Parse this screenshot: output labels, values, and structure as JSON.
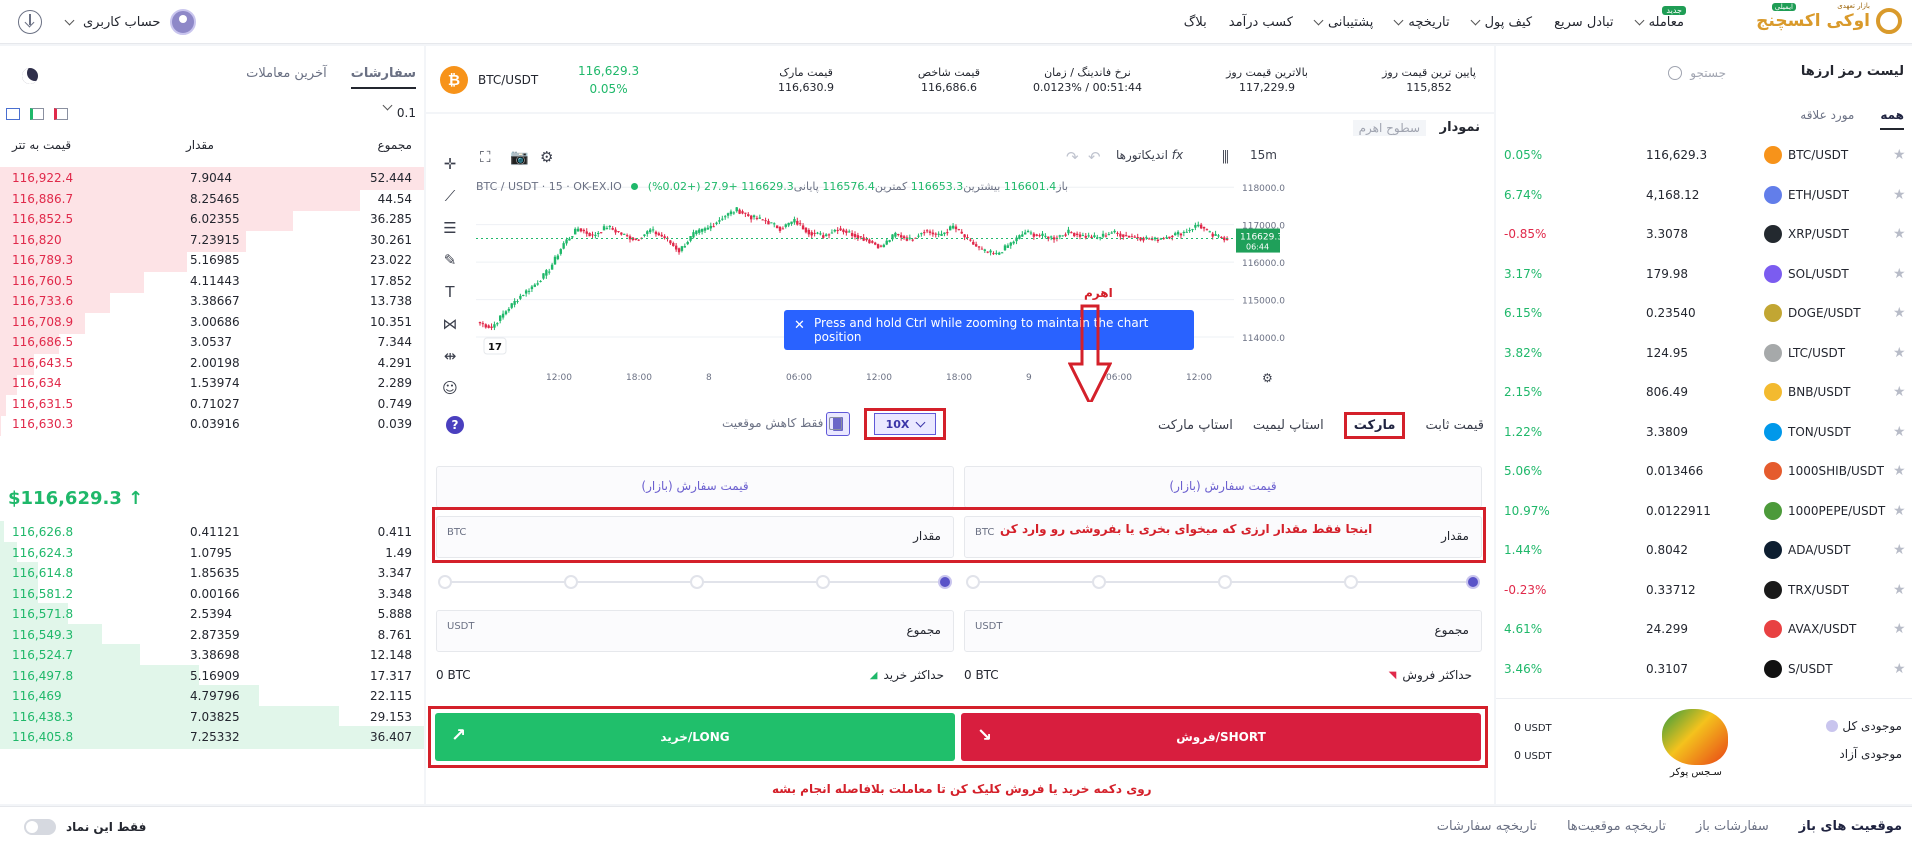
{
  "topbar": {
    "brand_name": "اوکی اکسچنج",
    "brand_tagline": "بازار تعهدی",
    "brand_badge": "ایمیلی",
    "nav": [
      {
        "label": "معامله",
        "badge": "جدید"
      },
      {
        "label": "تبادل سریع"
      },
      {
        "label": "کیف پول"
      },
      {
        "label": "تاریخچه"
      },
      {
        "label": "پشتیبانی"
      },
      {
        "label": "کسب درآمد"
      },
      {
        "label": "بلاگ"
      }
    ],
    "account_label": "حساب کاربری"
  },
  "market_list": {
    "title": "لیست رمز ارزها",
    "search_placeholder": "جستجو",
    "tabs": [
      "همه",
      "مورد علاقه"
    ],
    "pairs": [
      {
        "name": "BTC/USDT",
        "price": "116,629.3",
        "change": "0.05%",
        "dir": "pos",
        "color": "#f7931a"
      },
      {
        "name": "ETH/USDT",
        "price": "4,168.12",
        "change": "6.74%",
        "dir": "pos",
        "color": "#627eea"
      },
      {
        "name": "XRP/USDT",
        "price": "3.3078",
        "change": "-0.85%",
        "dir": "neg",
        "color": "#23292f"
      },
      {
        "name": "SOL/USDT",
        "price": "179.98",
        "change": "3.17%",
        "dir": "pos",
        "color": "#7b5cf0"
      },
      {
        "name": "DOGE/USDT",
        "price": "0.23540",
        "change": "6.15%",
        "dir": "pos",
        "color": "#c2a633"
      },
      {
        "name": "LTC/USDT",
        "price": "124.95",
        "change": "3.82%",
        "dir": "pos",
        "color": "#a6a9aa"
      },
      {
        "name": "BNB/USDT",
        "price": "806.49",
        "change": "2.15%",
        "dir": "pos",
        "color": "#f3ba2f"
      },
      {
        "name": "TON/USDT",
        "price": "3.3809",
        "change": "1.22%",
        "dir": "pos",
        "color": "#0098ea"
      },
      {
        "name": "1000SHIB/USDT",
        "price": "0.013466",
        "change": "5.06%",
        "dir": "pos",
        "color": "#e55b2d"
      },
      {
        "name": "1000PEPE/USDT",
        "price": "0.0122911",
        "change": "10.97%",
        "dir": "pos",
        "color": "#4c9a3a"
      },
      {
        "name": "ADA/USDT",
        "price": "0.8042",
        "change": "1.44%",
        "dir": "pos",
        "color": "#0d1e30"
      },
      {
        "name": "TRX/USDT",
        "price": "0.33712",
        "change": "-0.23%",
        "dir": "neg",
        "color": "#1a1a1a"
      },
      {
        "name": "AVAX/USDT",
        "price": "24.299",
        "change": "4.61%",
        "dir": "pos",
        "color": "#e84142"
      },
      {
        "name": "S/USDT",
        "price": "0.3107",
        "change": "3.46%",
        "dir": "pos",
        "color": "#111111"
      }
    ]
  },
  "balances": {
    "total_label": "موجودی کل",
    "total_value": "0",
    "total_unit": "USDT",
    "free_label": "موجودی آزاد",
    "free_value": "0",
    "free_unit": "USDT",
    "logo_caption": "سـجس پوکر"
  },
  "ticker": {
    "pair": "BTC/USDT",
    "price": "116,629.3",
    "change": "0.05%",
    "stats": [
      {
        "label": "پایین ترین قیمت روز",
        "value": "115,852"
      },
      {
        "label": "بالاترین قیمت روز",
        "value": "117,229.9"
      },
      {
        "label": "نرخ فاندینگ / زمان",
        "value": "00:51:44 / 0.0123%"
      },
      {
        "label": "قیمت شاخص",
        "value": "116,686.6"
      },
      {
        "label": "قیمت مارک",
        "value": "116,630.9"
      }
    ]
  },
  "chart": {
    "tab_chart": "نمودار",
    "tab_levels": "سطوح اهرم",
    "interval": "15m",
    "indicators": "اندیکاتورها",
    "symbol_line": "BTC / USDT · 15 · OK-EX.IO",
    "ohlc": {
      "o_label": "باز",
      "o": "116601.4",
      "h_label": "بیشترین",
      "h": "116653.3",
      "l_label": "کمترین",
      "l": "116576.4",
      "c_label": "پایانی",
      "c": "116629.3",
      "chg": "+27.9 (+0.02%)"
    },
    "price_tag": "116629.3",
    "price_tag_time": "06:44",
    "tip": "Press and hold Ctrl while zooming to maintain the chart position",
    "leverage_annotation": "اهرم"
  },
  "chart_data": {
    "type": "candlestick",
    "x_ticks": [
      "12:00",
      "18:00",
      "8",
      "06:00",
      "12:00",
      "18:00",
      "9",
      "06:00",
      "12:00"
    ],
    "y_ticks": [
      114000,
      115000,
      116000,
      117000,
      118000
    ],
    "ylim": [
      113600,
      118300
    ],
    "last_price": 116629.3,
    "close_path": [
      114400,
      114250,
      114700,
      115100,
      115400,
      115800,
      116500,
      116900,
      116700,
      116950,
      116750,
      116600,
      116850,
      116650,
      116300,
      116750,
      116900,
      117200,
      117400,
      117200,
      117100,
      116900,
      117100,
      116800,
      116700,
      116900,
      116750,
      116600,
      116400,
      116750,
      116600,
      116850,
      116700,
      116950,
      116600,
      116300,
      116200,
      116500,
      116800,
      116700,
      116650,
      116800,
      116700,
      116650,
      116800,
      116700,
      116650,
      116600,
      116700,
      116800,
      117000,
      116700,
      116630
    ]
  },
  "order_form": {
    "types": [
      "قیمت ثابت",
      "مارکت",
      "استاپ لیمیت",
      "استاپ مارکت"
    ],
    "active_type": "مارکت",
    "leverage": "10X",
    "reduce_only": "فقط کاهش موقعیت",
    "price_placeholder": "قیمت سفارش (بازار)",
    "amount_label": "مقدار",
    "amount_unit": "BTC",
    "amount_note": "اینجا فقط مقدار ارزی که میخوای بخری یا بفروشی رو وارد کن",
    "total_label": "مجموع",
    "total_unit": "USDT",
    "max_sell_label": "حداکثر فروش",
    "max_sell_value": "0 BTC",
    "max_buy_label": "حداکثر خرید",
    "max_buy_value": "0 BTC",
    "sell_button": "فروش/SHORT",
    "buy_button": "خرید/LONG",
    "button_note": "روی دکمه خرید یا فروش کلیک کن تا معاملت بلافاصله انجام بشه"
  },
  "orderbook": {
    "tabs": [
      "سفارشات",
      "آخرین معاملات"
    ],
    "precision": "0.1",
    "headers": {
      "price": "قیمت به تتر",
      "amount": "مقدار",
      "total": "مجموع"
    },
    "last_price": "$116,629.3",
    "asks": [
      {
        "price": "116,922.4",
        "amount": "7.9044",
        "total": "52.444",
        "depth": 1.0
      },
      {
        "price": "116,886.7",
        "amount": "8.25465",
        "total": "44.54",
        "depth": 0.85
      },
      {
        "price": "116,852.5",
        "amount": "6.02355",
        "total": "36.285",
        "depth": 0.69
      },
      {
        "price": "116,820",
        "amount": "7.23915",
        "total": "30.261",
        "depth": 0.58
      },
      {
        "price": "116,789.3",
        "amount": "5.16985",
        "total": "23.022",
        "depth": 0.44
      },
      {
        "price": "116,760.5",
        "amount": "4.11443",
        "total": "17.852",
        "depth": 0.34
      },
      {
        "price": "116,733.6",
        "amount": "3.38667",
        "total": "13.738",
        "depth": 0.26
      },
      {
        "price": "116,708.9",
        "amount": "3.00686",
        "total": "10.351",
        "depth": 0.2
      },
      {
        "price": "116,686.5",
        "amount": "3.0537",
        "total": "7.344",
        "depth": 0.14
      },
      {
        "price": "116,643.5",
        "amount": "2.00198",
        "total": "4.291",
        "depth": 0.08
      },
      {
        "price": "116,634",
        "amount": "1.53974",
        "total": "2.289",
        "depth": 0.04
      },
      {
        "price": "116,631.5",
        "amount": "0.71027",
        "total": "0.749",
        "depth": 0.014
      },
      {
        "price": "116,630.3",
        "amount": "0.03916",
        "total": "0.039",
        "depth": 0.001
      }
    ],
    "bids": [
      {
        "price": "116,626.8",
        "amount": "0.41121",
        "total": "0.411",
        "depth": 0.01
      },
      {
        "price": "116,624.3",
        "amount": "1.0795",
        "total": "1.49",
        "depth": 0.04
      },
      {
        "price": "116,614.8",
        "amount": "1.85635",
        "total": "3.347",
        "depth": 0.09
      },
      {
        "price": "116,581.2",
        "amount": "0.00166",
        "total": "3.348",
        "depth": 0.09
      },
      {
        "price": "116,571.8",
        "amount": "2.5394",
        "total": "5.888",
        "depth": 0.16
      },
      {
        "price": "116,549.3",
        "amount": "2.87359",
        "total": "8.761",
        "depth": 0.24
      },
      {
        "price": "116,524.7",
        "amount": "3.38698",
        "total": "12.148",
        "depth": 0.33
      },
      {
        "price": "116,497.8",
        "amount": "5.16909",
        "total": "17.317",
        "depth": 0.47
      },
      {
        "price": "116,469",
        "amount": "4.79796",
        "total": "22.115",
        "depth": 0.61
      },
      {
        "price": "116,438.3",
        "amount": "7.03825",
        "total": "29.153",
        "depth": 0.8
      },
      {
        "price": "116,405.8",
        "amount": "7.25332",
        "total": "36.407",
        "depth": 1.0
      }
    ]
  },
  "bottom": {
    "tabs": [
      "موقعیت های باز",
      "سفارشات باز",
      "تاریخچه موقعیت‌ها",
      "تاریخچه سفارشات"
    ],
    "only_symbol": "فقط این نماد"
  },
  "colors": {
    "up": "#1fb86a",
    "down": "#e0294a",
    "accent": "#5a53c8",
    "annotation": "#d4202a"
  }
}
